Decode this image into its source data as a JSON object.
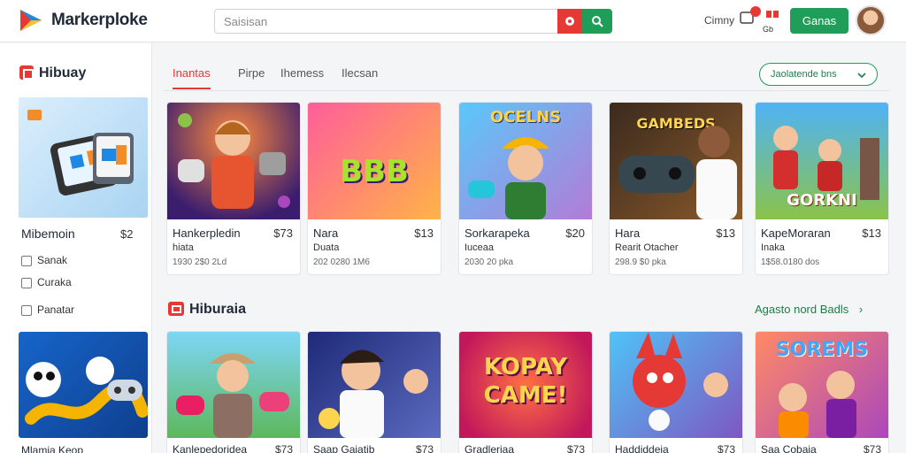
{
  "header": {
    "brand": "Markerploke",
    "search_placeholder": "Saisisan",
    "account_text": "Cimny",
    "icon_label": "Gb",
    "primary_button": "Ganas",
    "colors": {
      "accent_green": "#1e9e58",
      "accent_red": "#e53935"
    }
  },
  "sidebar": {
    "title": "Hibuay",
    "section_label": "Mibemoin",
    "section_count": "$2",
    "filters": [
      {
        "label": "Sanak"
      },
      {
        "label": "Curaka"
      },
      {
        "label": "Panatar"
      }
    ],
    "bottom_label": "Mlamia Keop"
  },
  "tabs": [
    {
      "label": "Inantas",
      "active": true
    },
    {
      "label": "Pirpe"
    },
    {
      "label": "Ihemess"
    },
    {
      "label": "Ilecsan"
    }
  ],
  "filter_button": "Jaolatende bns",
  "cards_row1": [
    {
      "name": "Hankerpledin",
      "price": "$73",
      "sub": "hiata",
      "meta": "1930 2$0 2Ld",
      "thumb_text": ""
    },
    {
      "name": "Nara",
      "price": "$13",
      "sub": "Duata",
      "meta": "202 0280 1M6",
      "thumb_text": "BBB"
    },
    {
      "name": "Sorkarapeka",
      "price": "$20",
      "sub": "Iuceaa",
      "meta": "2030 20 pka",
      "thumb_text": "OCELNS"
    },
    {
      "name": "Hara",
      "price": "$13",
      "sub": "Rearit Otacher",
      "meta": "298.9 $0 pka",
      "thumb_text": "GAMBEDS"
    },
    {
      "name": "KapeMoraran",
      "price": "$13",
      "sub": "Inaka",
      "meta": "1$58.0180 dos",
      "thumb_text": "GORKNI"
    }
  ],
  "section": {
    "title": "Hiburaia",
    "link": "Agasto nord Badls"
  },
  "cards_row2": [
    {
      "name": "Kanlepedoridea",
      "price": "$73",
      "thumb_text": ""
    },
    {
      "name": "Saap Gaiatib",
      "price": "$73",
      "thumb_text": ""
    },
    {
      "name": "Gradleriaa",
      "price": "$73",
      "thumb_text": "KOPAY CAME!"
    },
    {
      "name": "Haddiddeia",
      "price": "$73",
      "thumb_text": ""
    },
    {
      "name": "Saa Cobaia",
      "price": "$73",
      "thumb_text": "SOREMS"
    }
  ]
}
